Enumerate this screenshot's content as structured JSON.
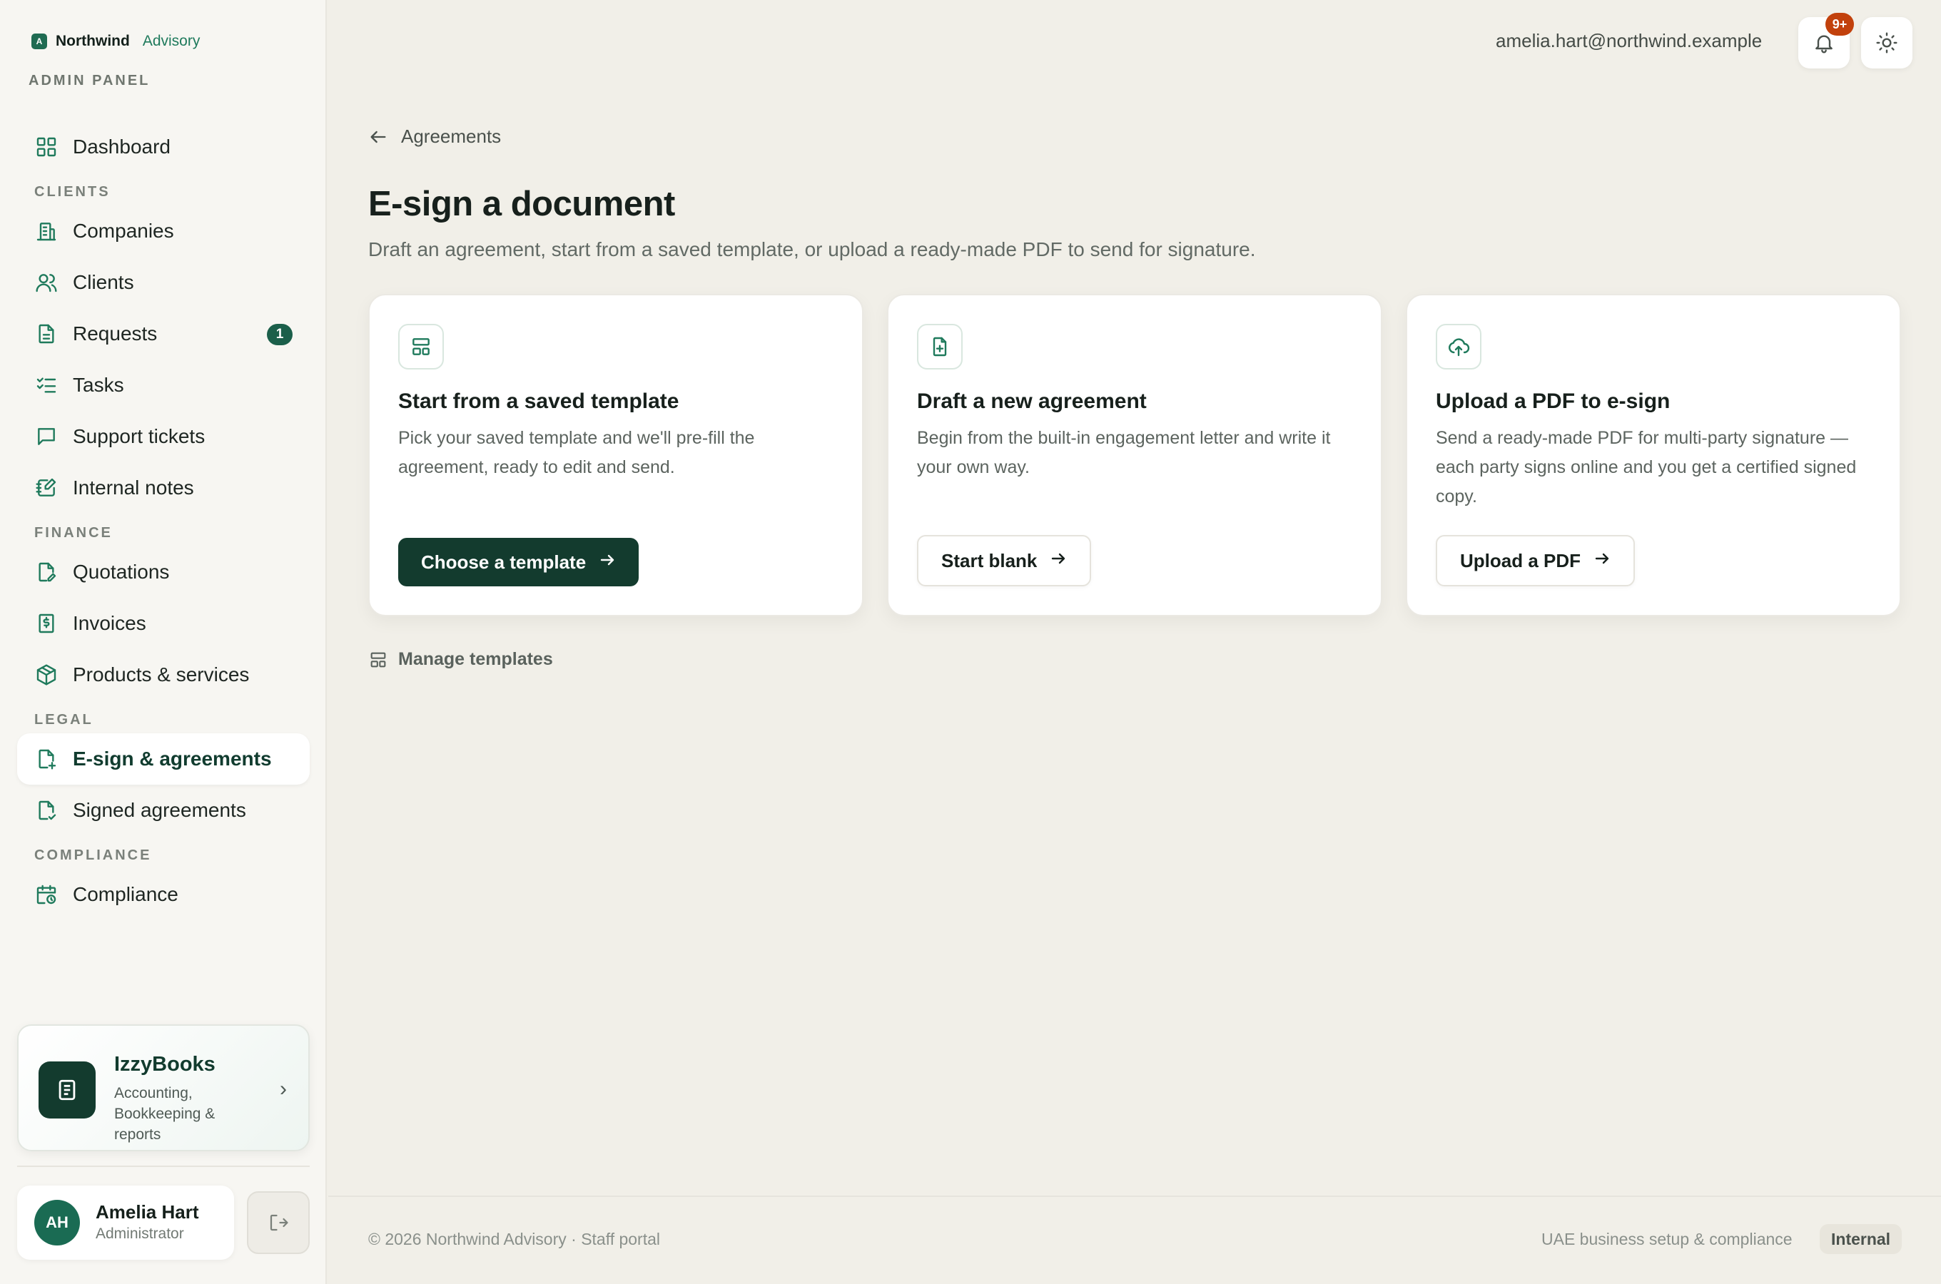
{
  "brand": {
    "logo_letter": "A",
    "name": "Northwind",
    "sub": "Advisory",
    "panel_label": "ADMIN PANEL",
    "accent": "#1f7a5c"
  },
  "sidebar": {
    "dashboard": "Dashboard",
    "sections": {
      "clients": "CLIENTS",
      "finance": "FINANCE",
      "legal": "LEGAL",
      "compliance": "COMPLIANCE"
    },
    "items": {
      "companies": "Companies",
      "clients": "Clients",
      "requests": "Requests",
      "requests_badge": "1",
      "tasks": "Tasks",
      "support_tickets": "Support tickets",
      "internal_notes": "Internal notes",
      "quotations": "Quotations",
      "invoices": "Invoices",
      "products": "Products & services",
      "esign": "E-sign & agreements",
      "signed": "Signed agreements",
      "compliance": "Compliance"
    },
    "active_item": "E-sign & agreements"
  },
  "promo": {
    "title": "IzzyBooks",
    "desc": "Accounting, Bookkeeping & reports",
    "icon": "book-icon"
  },
  "user": {
    "initials": "AH",
    "name": "Amelia Hart",
    "role": "Administrator"
  },
  "topbar": {
    "email": "amelia.hart@northwind.example",
    "notif_count": "9+"
  },
  "main": {
    "back_label": "Agreements",
    "title": "E-sign a document",
    "subtitle": "Draft an agreement, start from a saved template, or upload a ready-made PDF to send for signature.",
    "cards": [
      {
        "title": "Start from a saved template",
        "desc": "Pick your saved template and we'll pre-fill the agreement, ready to edit and send.",
        "button": "Choose a template",
        "icon": "template-icon"
      },
      {
        "title": "Draft a new agreement",
        "desc": "Begin from the built-in engagement letter and write it your own way.",
        "button": "Start blank",
        "icon": "file-plus-icon"
      },
      {
        "title": "Upload a PDF to e-sign",
        "desc": "Send a ready-made PDF for multi-party signature — each party signs online and you get a certified signed copy.",
        "button": "Upload a PDF",
        "icon": "cloud-upload-icon"
      }
    ],
    "manage_templates": "Manage templates"
  },
  "footer": {
    "left": "© 2026 Northwind Advisory · Staff portal",
    "right": "UAE business setup & compliance",
    "tag": "Internal"
  }
}
